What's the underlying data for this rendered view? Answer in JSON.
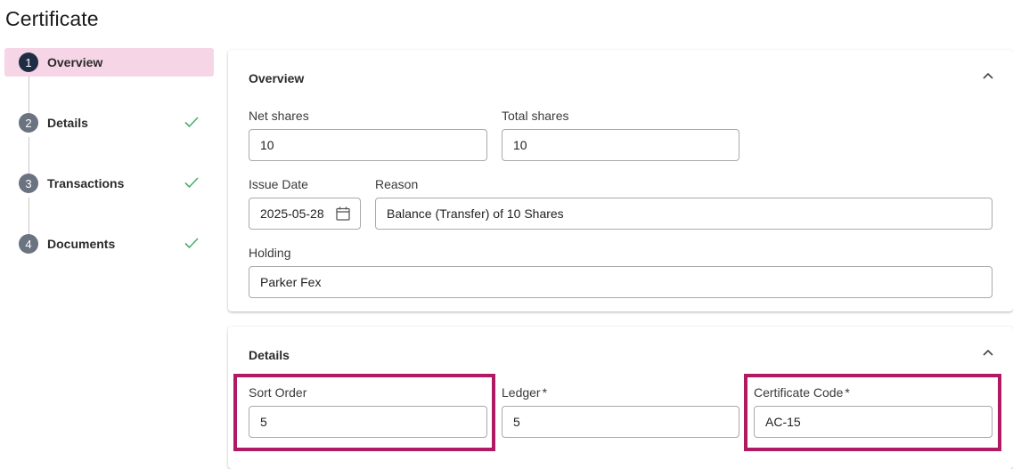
{
  "page": {
    "title": "Certificate"
  },
  "stepper": {
    "steps": [
      {
        "number": "1",
        "label": "Overview",
        "active": true,
        "completed": false
      },
      {
        "number": "2",
        "label": "Details",
        "active": false,
        "completed": true
      },
      {
        "number": "3",
        "label": "Transactions",
        "active": false,
        "completed": true
      },
      {
        "number": "4",
        "label": "Documents",
        "active": false,
        "completed": true
      }
    ]
  },
  "overview": {
    "title": "Overview",
    "net_shares": {
      "label": "Net shares",
      "value": "10"
    },
    "total_shares": {
      "label": "Total shares",
      "value": "10"
    },
    "issue_date": {
      "label": "Issue Date",
      "value": "2025-05-28"
    },
    "reason": {
      "label": "Reason",
      "value": "Balance (Transfer) of 10 Shares"
    },
    "holding": {
      "label": "Holding",
      "value": "Parker Fex"
    }
  },
  "details": {
    "title": "Details",
    "sort_order": {
      "label": "Sort Order",
      "value": "5"
    },
    "ledger": {
      "label": "Ledger",
      "required": "*",
      "value": "5"
    },
    "certificate_code": {
      "label": "Certificate Code",
      "required": "*",
      "value": "AC-15"
    }
  },
  "colors": {
    "active_step_bg": "#f5d5e6",
    "active_step_circle": "#1f2d44",
    "step_circle": "#6b7280",
    "check_green": "#4caf6a",
    "highlight_border": "#b01a63"
  }
}
